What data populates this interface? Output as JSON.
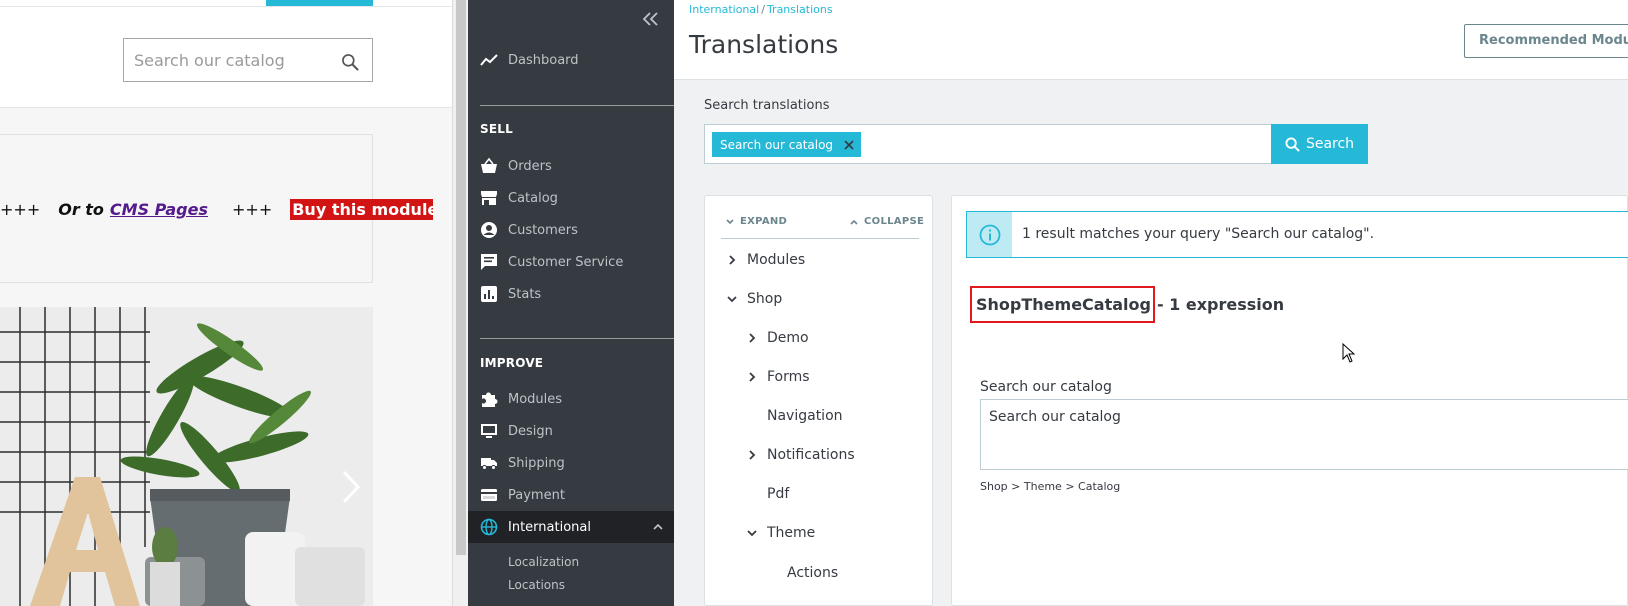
{
  "storefront": {
    "search_placeholder": "Search our catalog",
    "banner": {
      "plus_left": "+++",
      "or_to": "Or to",
      "cms_link": "CMS Pages",
      "plus_right": "+++",
      "buy_text": "Buy this module h"
    }
  },
  "sidebar": {
    "dashboard": "Dashboard",
    "sell_title": "SELL",
    "sell_items": [
      {
        "label": "Orders",
        "icon": "basket-icon"
      },
      {
        "label": "Catalog",
        "icon": "store-icon"
      },
      {
        "label": "Customers",
        "icon": "account-circle-icon"
      },
      {
        "label": "Customer Service",
        "icon": "chat-icon"
      },
      {
        "label": "Stats",
        "icon": "chart-icon"
      }
    ],
    "improve_title": "IMPROVE",
    "improve_items": [
      {
        "label": "Modules",
        "icon": "puzzle-icon"
      },
      {
        "label": "Design",
        "icon": "monitor-icon"
      },
      {
        "label": "Shipping",
        "icon": "truck-icon"
      },
      {
        "label": "Payment",
        "icon": "credit-card-icon"
      }
    ],
    "active_item": "International",
    "sub_items": [
      "Localization",
      "Locations"
    ]
  },
  "header": {
    "breadcrumb": [
      "International",
      "Translations"
    ],
    "breadcrumb_sep": "/",
    "title": "Translations",
    "recommended_button": "Recommended Modules"
  },
  "search": {
    "label": "Search translations",
    "tag": "Search our catalog",
    "button": "Search"
  },
  "tree": {
    "expand": "EXPAND",
    "collapse": "COLLAPSE",
    "items": [
      "Modules",
      "Shop",
      "Demo",
      "Forms",
      "Navigation",
      "Notifications",
      "Pdf",
      "Theme",
      "Actions"
    ]
  },
  "results": {
    "alert": "1 result matches your query \"Search our catalog\".",
    "domain_name": "ShopThemeCatalog",
    "domain_count": "- 1 expression",
    "field_label": "Search our catalog",
    "field_value": "Search our catalog",
    "field_path": "Shop > Theme > Catalog"
  },
  "colors": {
    "accent": "#25b9d7",
    "sidebar_bg": "#363a41",
    "highlight_red": "#e01a1a"
  }
}
